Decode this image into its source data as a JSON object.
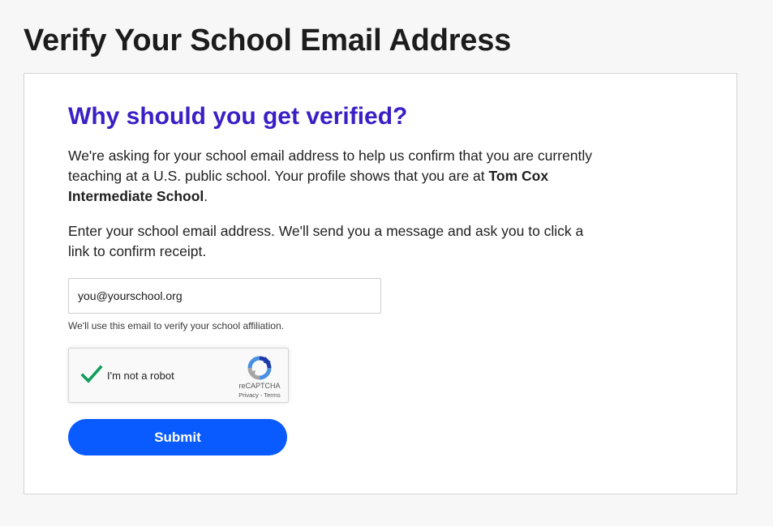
{
  "page": {
    "title": "Verify Your School Email Address"
  },
  "card": {
    "heading": "Why should you get verified?",
    "paragraph1": {
      "before": "We're asking for your school email address to help us confirm that you are currently teaching at a U.S. public school. Your profile shows that you are at ",
      "school_name": "Tom Cox Intermediate School",
      "after": "."
    },
    "paragraph2": "Enter your school email address. We'll send you a message and ask you to click a link to confirm receipt.",
    "email_field": {
      "placeholder": "you@yourschool.org",
      "value": ""
    },
    "helper_text": "We'll use this email to verify your school affiliation.",
    "recaptcha": {
      "checked": true,
      "label": "I'm not a robot",
      "brand": "reCAPTCHA",
      "privacy": "Privacy",
      "separator": " - ",
      "terms": "Terms"
    },
    "submit_label": "Submit"
  },
  "colors": {
    "heading": "#3b1fc6",
    "primary_button": "#0a5bff",
    "check": "#0f9d58",
    "page_background": "#f7f7f7"
  },
  "icons": {
    "check": "check-icon",
    "recaptcha_logo": "recaptcha-logo-icon"
  }
}
